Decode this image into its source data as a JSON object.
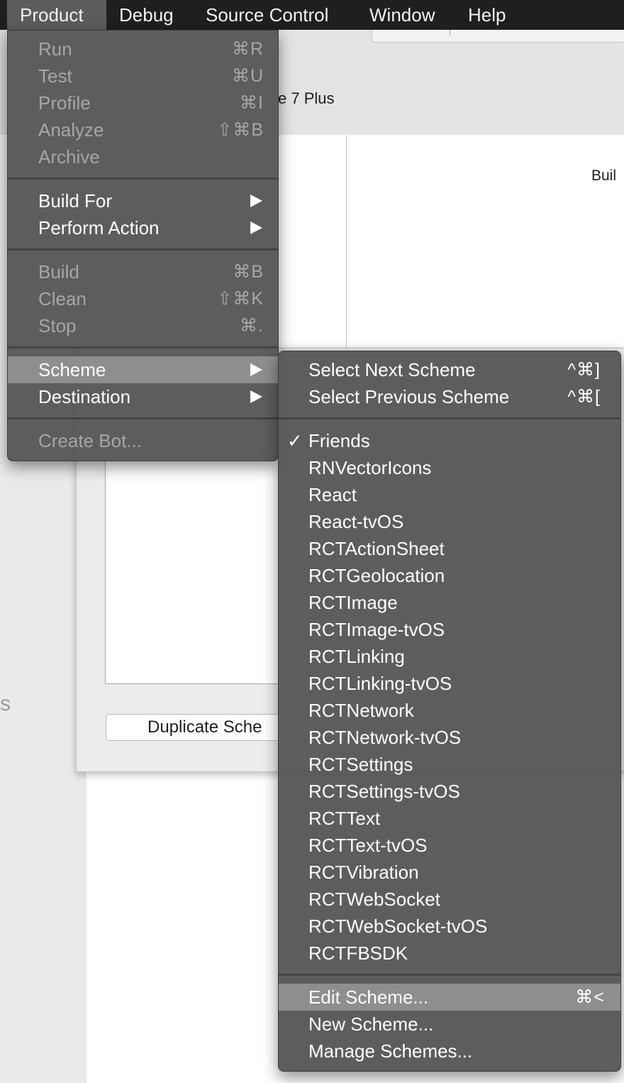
{
  "menubar": {
    "items": [
      {
        "label": "Product"
      },
      {
        "label": "Debug"
      },
      {
        "label": "Source Control"
      },
      {
        "label": "Window"
      },
      {
        "label": "Help"
      }
    ]
  },
  "background": {
    "device_fragment": "e 7 Plus",
    "build_label": "Buil",
    "duplicate_button": "Duplicate Sche",
    "sidebar_fragment": "s"
  },
  "product_menu": {
    "run": {
      "label": "Run",
      "shortcut": "⌘R"
    },
    "test": {
      "label": "Test",
      "shortcut": "⌘U"
    },
    "profile": {
      "label": "Profile",
      "shortcut": "⌘I"
    },
    "analyze": {
      "label": "Analyze",
      "shortcut": "⇧⌘B"
    },
    "archive": {
      "label": "Archive"
    },
    "build_for": {
      "label": "Build For"
    },
    "perform_action": {
      "label": "Perform Action"
    },
    "build": {
      "label": "Build",
      "shortcut": "⌘B"
    },
    "clean": {
      "label": "Clean",
      "shortcut": "⇧⌘K"
    },
    "stop": {
      "label": "Stop",
      "shortcut": "⌘."
    },
    "scheme": {
      "label": "Scheme"
    },
    "destination": {
      "label": "Destination"
    },
    "create_bot": {
      "label": "Create Bot..."
    }
  },
  "scheme_menu": {
    "select_next": {
      "label": "Select Next Scheme",
      "shortcut": "^⌘]"
    },
    "select_previous": {
      "label": "Select Previous Scheme",
      "shortcut": "^⌘["
    },
    "checkmark": "✓",
    "schemes": [
      "Friends",
      "RNVectorIcons",
      "React",
      "React-tvOS",
      "RCTActionSheet",
      "RCTGeolocation",
      "RCTImage",
      "RCTImage-tvOS",
      "RCTLinking",
      "RCTLinking-tvOS",
      "RCTNetwork",
      "RCTNetwork-tvOS",
      "RCTSettings",
      "RCTSettings-tvOS",
      "RCTText",
      "RCTText-tvOS",
      "RCTVibration",
      "RCTWebSocket",
      "RCTWebSocket-tvOS",
      "RCTFBSDK"
    ],
    "edit_scheme": {
      "label": "Edit Scheme...",
      "shortcut": "⌘<"
    },
    "new_scheme": {
      "label": "New Scheme..."
    },
    "manage_schemes": {
      "label": "Manage Schemes..."
    }
  },
  "colors": {
    "menubar": "#1f1f1f",
    "menu_bg": "#585858",
    "highlight": "#8e8e8e",
    "disabled_text": "#a6a6a6"
  }
}
